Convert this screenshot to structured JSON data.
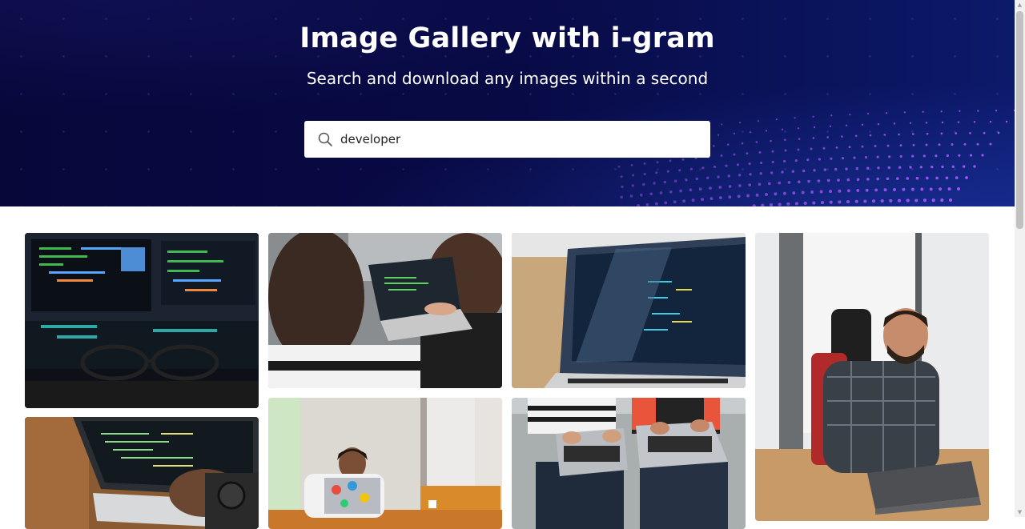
{
  "hero": {
    "title": "Image Gallery with i-gram",
    "subtitle": "Search and download any images within a second"
  },
  "search": {
    "value": "developer",
    "icon": "search-icon"
  },
  "gallery": {
    "images": [
      "monitors-with-code-and-glasses",
      "two-women-pointing-at-laptop",
      "laptop-with-code-and-shadows",
      "man-in-plaid-shirt-with-laptop",
      "hands-typing-on-laptop-with-watch",
      "stressed-developer-with-sticker-laptop",
      "two-people-with-laptops-on-laps"
    ]
  },
  "colors": {
    "hero_bg": "#07073a",
    "accent_wave": "#b05cff"
  }
}
